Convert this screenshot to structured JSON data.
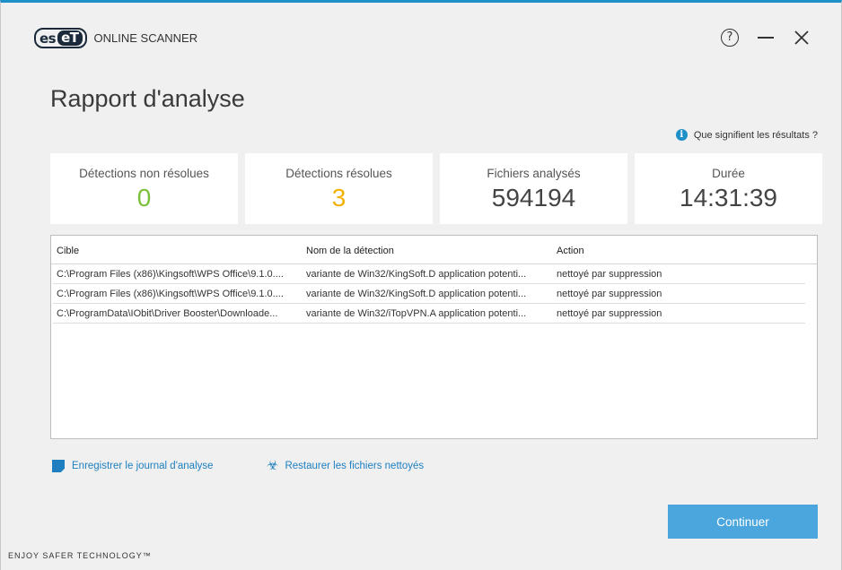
{
  "app": {
    "logo_left": "es",
    "logo_right": "eT",
    "product": "ONLINE SCANNER"
  },
  "window_controls": {
    "help": "?",
    "close": "✕"
  },
  "page": {
    "title": "Rapport d'analyse",
    "help_link": "Que signifient les résultats ?"
  },
  "stats": [
    {
      "label": "Détections non résolues",
      "value": "0"
    },
    {
      "label": "Détections résolues",
      "value": "3"
    },
    {
      "label": "Fichiers analysés",
      "value": "594194"
    },
    {
      "label": "Durée",
      "value": "14:31:39"
    }
  ],
  "table": {
    "headers": {
      "cible": "Cible",
      "nom": "Nom de la détection",
      "action": "Action"
    },
    "rows": [
      {
        "cible": "C:\\Program Files (x86)\\Kingsoft\\WPS Office\\9.1.0....",
        "nom": "variante de Win32/KingSoft.D application potenti...",
        "action": "nettoyé par suppression"
      },
      {
        "cible": "C:\\Program Files (x86)\\Kingsoft\\WPS Office\\9.1.0....",
        "nom": "variante de Win32/KingSoft.D application potenti...",
        "action": "nettoyé par suppression"
      },
      {
        "cible": "C:\\ProgramData\\IObit\\Driver Booster\\Downloade...",
        "nom": "variante de Win32/iTopVPN.A application potenti...",
        "action": "nettoyé par suppression"
      }
    ]
  },
  "links": {
    "save_log": "Enregistrer le journal d'analyse",
    "restore": "Restaurer les fichiers nettoyés"
  },
  "buttons": {
    "continue": "Continuer"
  },
  "footer": {
    "brand": "ENJOY SAFER TECHNOLOGY™"
  },
  "colors": {
    "accent": "#1e90c8",
    "button": "#4aa6dc",
    "unresolved": "#7bbf3a",
    "resolved": "#f2b200"
  },
  "icons": [
    "help-icon",
    "minimize-icon",
    "close-icon",
    "info-icon",
    "save-icon",
    "biohazard-icon"
  ]
}
